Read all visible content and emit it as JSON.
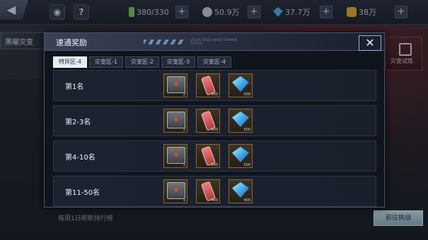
{
  "topbar": {
    "back_icon": "back-arrow-icon",
    "resources": [
      {
        "icon": "battery-icon",
        "value": "380/330",
        "color": "#7ccf5e"
      },
      {
        "icon": "silver-coin-icon",
        "value": "50.9万",
        "color": "#c8d3e6"
      },
      {
        "icon": "diamond-icon",
        "value": "37.7万",
        "color": "#4fb6f2"
      },
      {
        "icon": "gold-coin-icon",
        "value": "38万",
        "color": "#e8b23a"
      }
    ],
    "help_label": "?"
  },
  "side": {
    "left_tab_label": "黑曜灾变",
    "right_label": "灾变试炼",
    "bottom_hint": "每周1日刷新排行榜",
    "goto_label": "前往挑战"
  },
  "modal": {
    "title": "速通奖励",
    "close_label": "✕",
    "small_text": "LEGION SPEED AWARD TERMINAL SYSTEM",
    "tabs": [
      "特异区-4",
      "灾变区-1",
      "灾变区-2",
      "灾变区-3",
      "灾变区-4"
    ],
    "active_tab": 0,
    "rows": [
      {
        "rank": "第1名",
        "items": [
          {
            "type": "chest",
            "qty": "2"
          },
          {
            "type": "battery",
            "qty": "500"
          },
          {
            "type": "diamond",
            "qty": "500"
          }
        ]
      },
      {
        "rank": "第2-3名",
        "items": [
          {
            "type": "chest",
            "qty": "2"
          },
          {
            "type": "battery",
            "qty": "500"
          },
          {
            "type": "diamond",
            "qty": "500"
          }
        ]
      },
      {
        "rank": "第4-10名",
        "items": [
          {
            "type": "chest",
            "qty": "1"
          },
          {
            "type": "battery",
            "qty": "500"
          },
          {
            "type": "diamond",
            "qty": "500"
          }
        ]
      },
      {
        "rank": "第11-50名",
        "items": [
          {
            "type": "chest",
            "qty": "1"
          },
          {
            "type": "battery",
            "qty": "400"
          },
          {
            "type": "diamond",
            "qty": "400"
          }
        ]
      }
    ]
  }
}
